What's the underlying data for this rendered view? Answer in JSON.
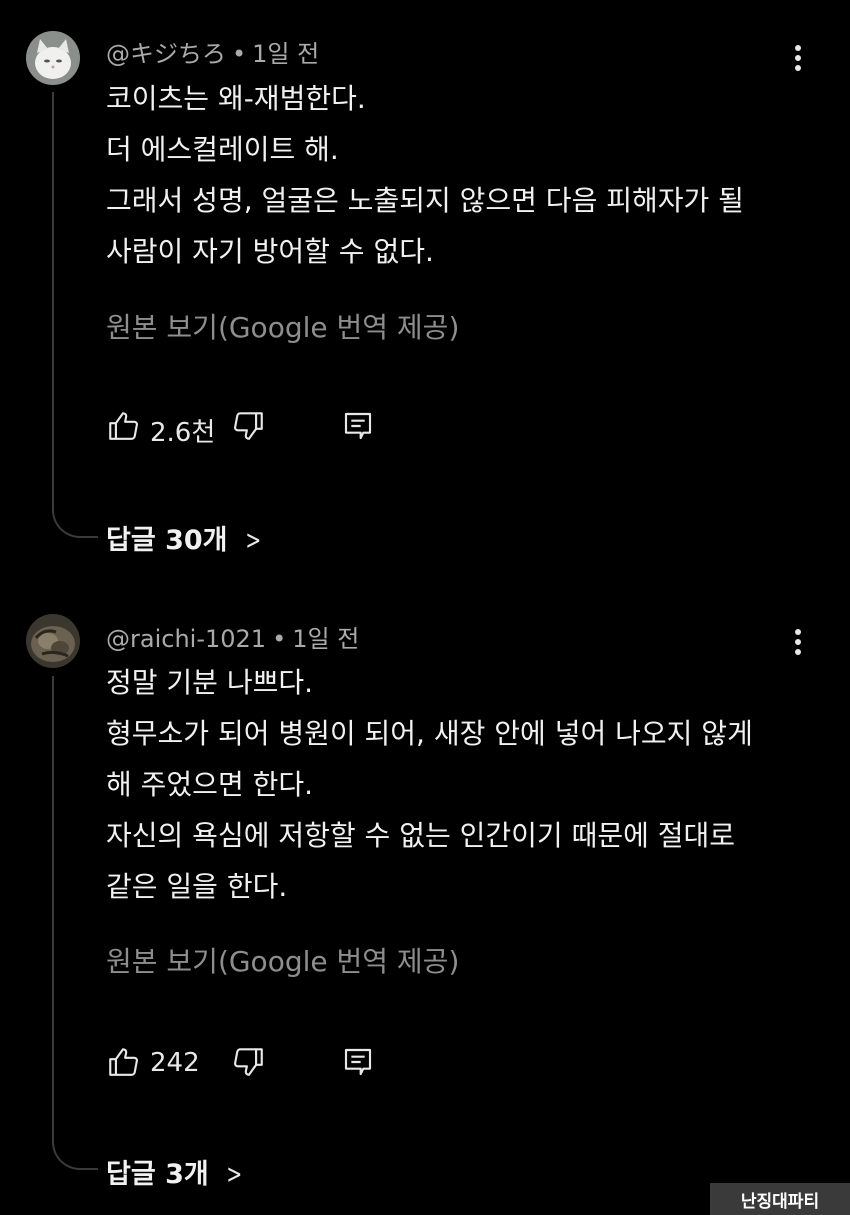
{
  "comments": [
    {
      "author": "@キジちろ",
      "time": "1일 전",
      "lines": [
        "코이츠는 왜-재범한다.",
        "더 에스컬레이트 해.",
        "그래서 성명, 얼굴은 노출되지 않으면 다음 피해자가 될",
        "사람이 자기 방어할 수 없다."
      ],
      "translate_label": "원본 보기(Google 번역 제공)",
      "likes": "2.6천",
      "replies_label": "답글 30개"
    },
    {
      "author": "@raichi-1021",
      "time": "1일 전",
      "lines": [
        "정말 기분 나쁘다.",
        "형무소가 되어 병원이 되어, 새장 안에 넣어 나오지 않게",
        "해 주었으면 한다.",
        "자신의 욕심에 저항할 수 없는 인간이기 때문에 절대로",
        "같은 일을 한다."
      ],
      "translate_label": "원본 보기(Google 번역 제공)",
      "likes": "242",
      "replies_label": "답글 3개"
    }
  ],
  "icons": {
    "like": "thumbs-up-icon",
    "dislike": "thumbs-down-icon",
    "reply": "reply-comment-icon",
    "more": "more-vertical-icon",
    "chevron": "chevron-right-icon"
  },
  "watermark": "난징대파티",
  "colors": {
    "background": "#000000",
    "meta": "#aaaaaa",
    "translate": "#8e8e8e",
    "text": "#f1f1f1"
  }
}
